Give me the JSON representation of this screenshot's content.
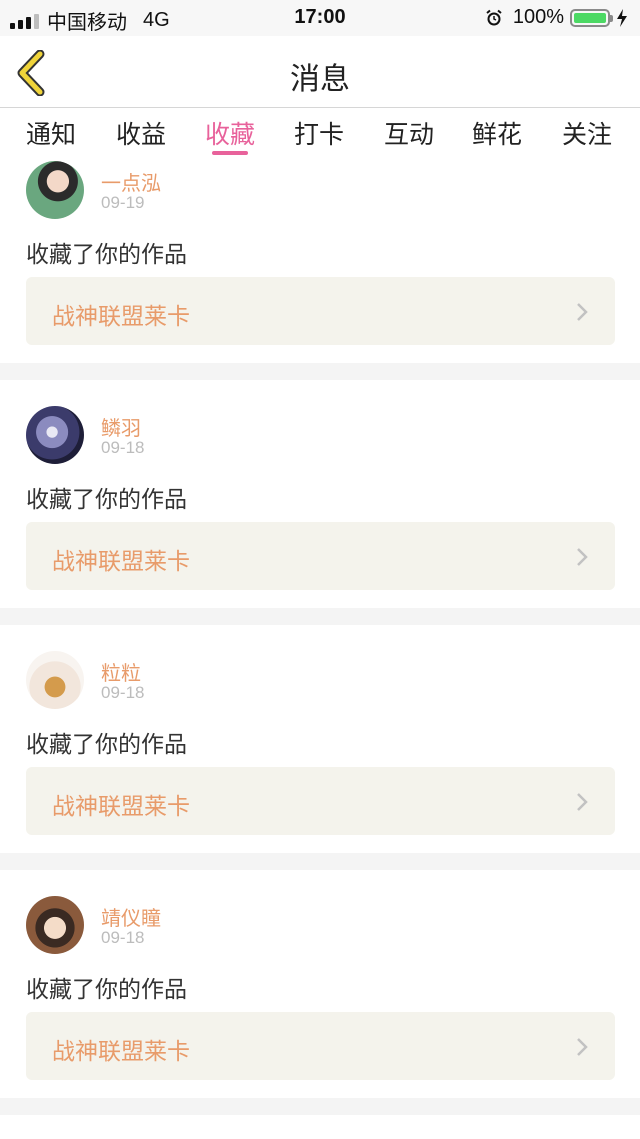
{
  "status_bar": {
    "carrier": "中国移动",
    "network": "4G",
    "time": "17:00",
    "battery": "100%",
    "icons": [
      "signal-icon",
      "alarm-icon",
      "battery-icon",
      "charging-bolt-icon"
    ]
  },
  "nav": {
    "title": "消息",
    "back_icon": "chevron-left-icon"
  },
  "tabs": [
    {
      "label": "通知"
    },
    {
      "label": "收益"
    },
    {
      "label": "收藏"
    },
    {
      "label": "打卡"
    },
    {
      "label": "互动"
    },
    {
      "label": "鲜花"
    },
    {
      "label": "关注"
    }
  ],
  "active_tab": "收藏",
  "feed": [
    {
      "user": "一点泓",
      "date": "09-19",
      "action": "收藏了你的作品",
      "work": "战神联盟莱卡"
    },
    {
      "user": "鳞羽",
      "date": "09-18",
      "action": "收藏了你的作品",
      "work": "战神联盟莱卡"
    },
    {
      "user": "粒粒",
      "date": "09-18",
      "action": "收藏了你的作品",
      "work": "战神联盟莱卡"
    },
    {
      "user": "靖仪瞳",
      "date": "09-18",
      "action": "收藏了你的作品",
      "work": "战神联盟莱卡"
    }
  ],
  "colors": {
    "accent_pink": "#e8629b",
    "username_orange": "#e89b6a",
    "back_arrow_yellow": "#f0d43a",
    "battery_green": "#4cd964",
    "card_link_bg": "#f4f3ec"
  }
}
